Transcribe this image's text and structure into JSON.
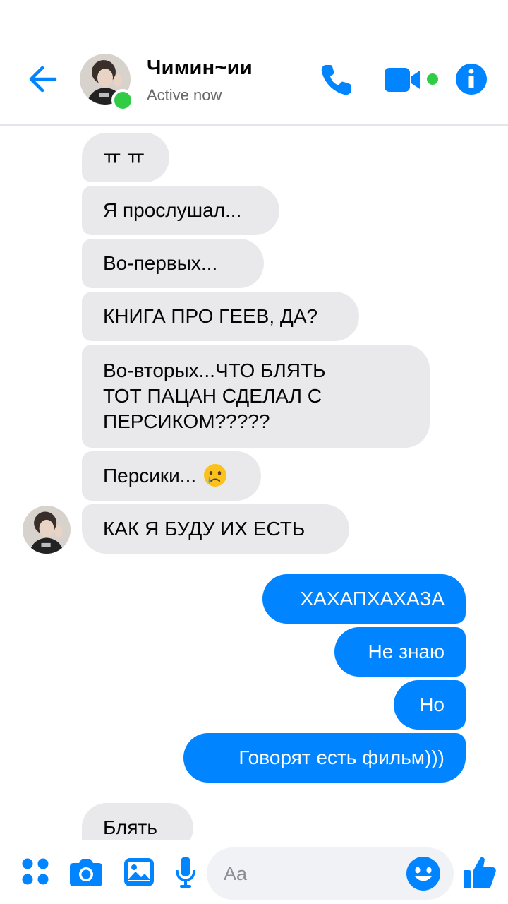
{
  "header": {
    "contact_name": "Чимин~ии",
    "status": "Active now"
  },
  "colors": {
    "accent": "#0084ff",
    "online": "#31cc46",
    "incoming_bubble": "#e9e9eb",
    "outgoing_bubble": "#0084ff"
  },
  "messages": [
    {
      "direction": "in",
      "text": "ㅠ ㅠ"
    },
    {
      "direction": "in",
      "text": "Я прослушал..."
    },
    {
      "direction": "in",
      "text": "Во-первых..."
    },
    {
      "direction": "in",
      "text": "КНИГА ПРО ГЕЕВ, ДА?"
    },
    {
      "direction": "in",
      "lines": [
        "Во-вторых...ЧТО БЛЯТЬ",
        "ТОТ ПАЦАН СДЕЛАЛ С",
        "ПЕРСИКОМ?????"
      ]
    },
    {
      "direction": "in",
      "text": "Персики...",
      "emoji": "crying-face"
    },
    {
      "direction": "in",
      "text": "КАК Я БУДУ ИХ ЕСТЬ"
    },
    {
      "direction": "out",
      "text": "ХАХАПХАХАЗА"
    },
    {
      "direction": "out",
      "text": "Не знаю"
    },
    {
      "direction": "out",
      "text": "Но"
    },
    {
      "direction": "out",
      "text": "Говорят есть фильм)))"
    },
    {
      "direction": "in",
      "text": "Блять"
    }
  ],
  "composer": {
    "placeholder": "Aa"
  },
  "icons": [
    "back-arrow-icon",
    "phone-icon",
    "video-camera-icon",
    "info-icon",
    "apps-icon",
    "camera-icon",
    "gallery-icon",
    "microphone-icon",
    "emoji-icon",
    "thumbs-up-icon"
  ]
}
